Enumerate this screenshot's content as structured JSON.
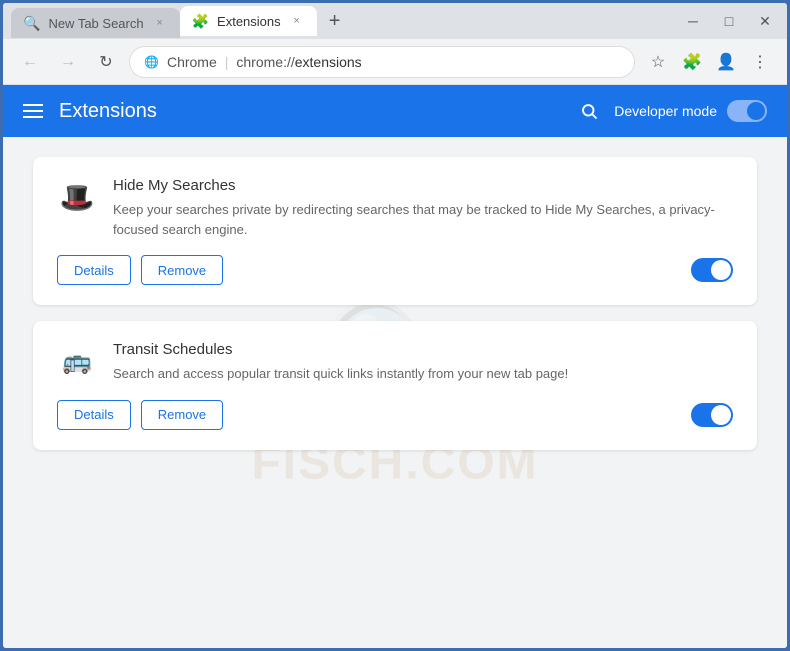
{
  "browser": {
    "tabs": [
      {
        "id": "tab-1",
        "label": "New Tab Search",
        "icon": "🔍",
        "active": false,
        "close_label": "×"
      },
      {
        "id": "tab-2",
        "label": "Extensions",
        "icon": "🧩",
        "active": true,
        "close_label": "×"
      }
    ],
    "new_tab_label": "+",
    "window_controls": {
      "minimize": "─",
      "maximize": "□",
      "close": "✕"
    },
    "address_bar": {
      "back_icon": "←",
      "forward_icon": "→",
      "refresh_icon": "↻",
      "site_icon": "🌐",
      "site_name": "Chrome",
      "separator": "|",
      "url_scheme": "chrome://",
      "url_path": "extensions",
      "bookmark_icon": "☆",
      "profile_icon": "👤",
      "menu_icon": "⋮"
    }
  },
  "extensions_page": {
    "hamburger_label": "menu",
    "title": "Extensions",
    "developer_mode_label": "Developer mode",
    "search_label": "search"
  },
  "extensions": [
    {
      "id": "hide-my-searches",
      "name": "Hide My Searches",
      "description": "Keep your searches private by redirecting searches that may be tracked to Hide My Searches, a privacy-focused search engine.",
      "icon": "🎩",
      "details_label": "Details",
      "remove_label": "Remove",
      "enabled": true
    },
    {
      "id": "transit-schedules",
      "name": "Transit Schedules",
      "description": "Search and access popular transit quick links instantly from your new tab page!",
      "icon": "🚌",
      "details_label": "Details",
      "remove_label": "Remove",
      "enabled": true
    }
  ]
}
